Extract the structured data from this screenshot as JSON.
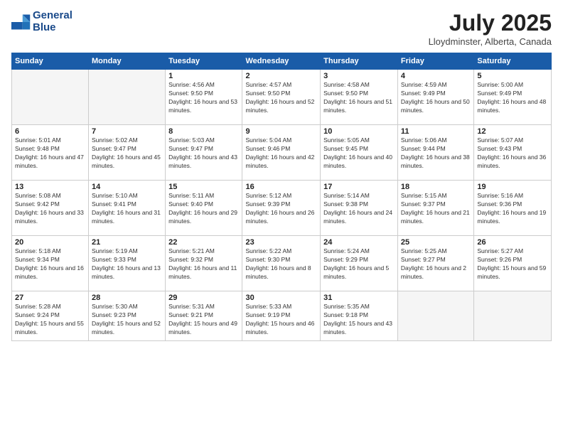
{
  "header": {
    "logo_line1": "General",
    "logo_line2": "Blue",
    "month_year": "July 2025",
    "location": "Lloydminster, Alberta, Canada"
  },
  "days_of_week": [
    "Sunday",
    "Monday",
    "Tuesday",
    "Wednesday",
    "Thursday",
    "Friday",
    "Saturday"
  ],
  "weeks": [
    [
      {
        "day": "",
        "info": ""
      },
      {
        "day": "",
        "info": ""
      },
      {
        "day": "1",
        "info": "Sunrise: 4:56 AM\nSunset: 9:50 PM\nDaylight: 16 hours and 53 minutes."
      },
      {
        "day": "2",
        "info": "Sunrise: 4:57 AM\nSunset: 9:50 PM\nDaylight: 16 hours and 52 minutes."
      },
      {
        "day": "3",
        "info": "Sunrise: 4:58 AM\nSunset: 9:50 PM\nDaylight: 16 hours and 51 minutes."
      },
      {
        "day": "4",
        "info": "Sunrise: 4:59 AM\nSunset: 9:49 PM\nDaylight: 16 hours and 50 minutes."
      },
      {
        "day": "5",
        "info": "Sunrise: 5:00 AM\nSunset: 9:49 PM\nDaylight: 16 hours and 48 minutes."
      }
    ],
    [
      {
        "day": "6",
        "info": "Sunrise: 5:01 AM\nSunset: 9:48 PM\nDaylight: 16 hours and 47 minutes."
      },
      {
        "day": "7",
        "info": "Sunrise: 5:02 AM\nSunset: 9:47 PM\nDaylight: 16 hours and 45 minutes."
      },
      {
        "day": "8",
        "info": "Sunrise: 5:03 AM\nSunset: 9:47 PM\nDaylight: 16 hours and 43 minutes."
      },
      {
        "day": "9",
        "info": "Sunrise: 5:04 AM\nSunset: 9:46 PM\nDaylight: 16 hours and 42 minutes."
      },
      {
        "day": "10",
        "info": "Sunrise: 5:05 AM\nSunset: 9:45 PM\nDaylight: 16 hours and 40 minutes."
      },
      {
        "day": "11",
        "info": "Sunrise: 5:06 AM\nSunset: 9:44 PM\nDaylight: 16 hours and 38 minutes."
      },
      {
        "day": "12",
        "info": "Sunrise: 5:07 AM\nSunset: 9:43 PM\nDaylight: 16 hours and 36 minutes."
      }
    ],
    [
      {
        "day": "13",
        "info": "Sunrise: 5:08 AM\nSunset: 9:42 PM\nDaylight: 16 hours and 33 minutes."
      },
      {
        "day": "14",
        "info": "Sunrise: 5:10 AM\nSunset: 9:41 PM\nDaylight: 16 hours and 31 minutes."
      },
      {
        "day": "15",
        "info": "Sunrise: 5:11 AM\nSunset: 9:40 PM\nDaylight: 16 hours and 29 minutes."
      },
      {
        "day": "16",
        "info": "Sunrise: 5:12 AM\nSunset: 9:39 PM\nDaylight: 16 hours and 26 minutes."
      },
      {
        "day": "17",
        "info": "Sunrise: 5:14 AM\nSunset: 9:38 PM\nDaylight: 16 hours and 24 minutes."
      },
      {
        "day": "18",
        "info": "Sunrise: 5:15 AM\nSunset: 9:37 PM\nDaylight: 16 hours and 21 minutes."
      },
      {
        "day": "19",
        "info": "Sunrise: 5:16 AM\nSunset: 9:36 PM\nDaylight: 16 hours and 19 minutes."
      }
    ],
    [
      {
        "day": "20",
        "info": "Sunrise: 5:18 AM\nSunset: 9:34 PM\nDaylight: 16 hours and 16 minutes."
      },
      {
        "day": "21",
        "info": "Sunrise: 5:19 AM\nSunset: 9:33 PM\nDaylight: 16 hours and 13 minutes."
      },
      {
        "day": "22",
        "info": "Sunrise: 5:21 AM\nSunset: 9:32 PM\nDaylight: 16 hours and 11 minutes."
      },
      {
        "day": "23",
        "info": "Sunrise: 5:22 AM\nSunset: 9:30 PM\nDaylight: 16 hours and 8 minutes."
      },
      {
        "day": "24",
        "info": "Sunrise: 5:24 AM\nSunset: 9:29 PM\nDaylight: 16 hours and 5 minutes."
      },
      {
        "day": "25",
        "info": "Sunrise: 5:25 AM\nSunset: 9:27 PM\nDaylight: 16 hours and 2 minutes."
      },
      {
        "day": "26",
        "info": "Sunrise: 5:27 AM\nSunset: 9:26 PM\nDaylight: 15 hours and 59 minutes."
      }
    ],
    [
      {
        "day": "27",
        "info": "Sunrise: 5:28 AM\nSunset: 9:24 PM\nDaylight: 15 hours and 55 minutes."
      },
      {
        "day": "28",
        "info": "Sunrise: 5:30 AM\nSunset: 9:23 PM\nDaylight: 15 hours and 52 minutes."
      },
      {
        "day": "29",
        "info": "Sunrise: 5:31 AM\nSunset: 9:21 PM\nDaylight: 15 hours and 49 minutes."
      },
      {
        "day": "30",
        "info": "Sunrise: 5:33 AM\nSunset: 9:19 PM\nDaylight: 15 hours and 46 minutes."
      },
      {
        "day": "31",
        "info": "Sunrise: 5:35 AM\nSunset: 9:18 PM\nDaylight: 15 hours and 43 minutes."
      },
      {
        "day": "",
        "info": ""
      },
      {
        "day": "",
        "info": ""
      }
    ]
  ]
}
